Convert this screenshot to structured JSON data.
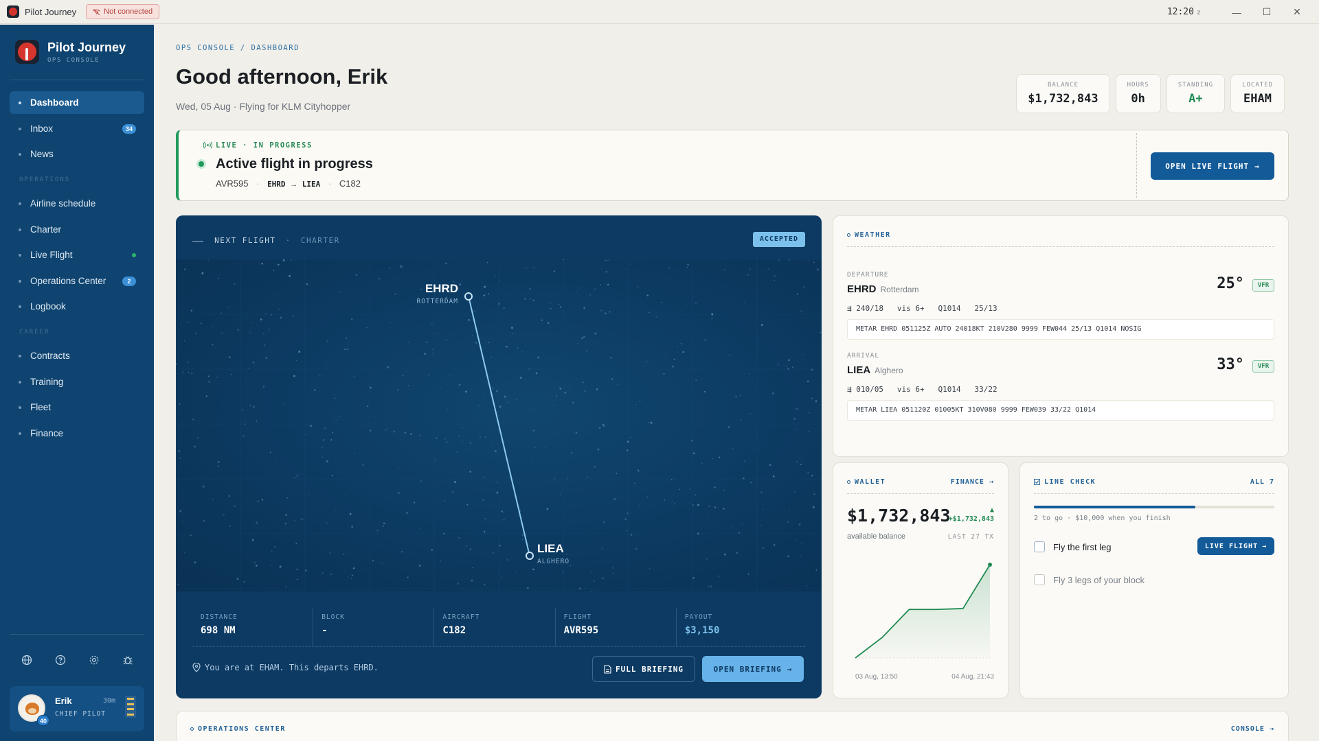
{
  "titlebar": {
    "app_name": "Pilot Journey",
    "connection_status": "Not connected",
    "clock": "12:20",
    "clock_suffix": "z"
  },
  "sidebar": {
    "brand_name": "Pilot Journey",
    "brand_sub": "OPS CONSOLE",
    "items": [
      {
        "label": "Dashboard",
        "active": true
      },
      {
        "label": "Inbox",
        "badge": "34"
      },
      {
        "label": "News"
      }
    ],
    "sections": [
      {
        "title": "OPERATIONS",
        "items": [
          {
            "label": "Airline schedule"
          },
          {
            "label": "Charter"
          },
          {
            "label": "Live Flight",
            "live": true
          },
          {
            "label": "Operations Center",
            "badge": "2"
          },
          {
            "label": "Logbook"
          }
        ]
      },
      {
        "title": "CAREER",
        "items": [
          {
            "label": "Contracts"
          },
          {
            "label": "Training"
          },
          {
            "label": "Fleet"
          },
          {
            "label": "Finance"
          }
        ]
      }
    ],
    "tools": [
      "globe-icon",
      "help-icon",
      "settings-icon",
      "bug-icon"
    ],
    "user": {
      "name": "Erik",
      "time": "30m",
      "role": "CHIEF PILOT",
      "level": "40"
    }
  },
  "header": {
    "breadcrumb": "OPS CONSOLE / DASHBOARD",
    "greeting": "Good afternoon, Erik",
    "subtitle": "Wed, 05 Aug · Flying for KLM Cityhopper",
    "stats": [
      {
        "label": "BALANCE",
        "value": "$1,732,843"
      },
      {
        "label": "HOURS",
        "value": "0h"
      },
      {
        "label": "STANDING",
        "value": "A+",
        "color": "#1f8a52"
      },
      {
        "label": "LOCATED",
        "value": "EHAM"
      }
    ]
  },
  "live_flight": {
    "status": "LIVE · IN PROGRESS",
    "title": "Active flight in progress",
    "flight": "AVR595",
    "from": "EHRD",
    "to": "LIEA",
    "aircraft": "C182",
    "button": "OPEN LIVE FLIGHT"
  },
  "next_flight": {
    "label": "NEXT FLIGHT",
    "type": "CHARTER",
    "status": "ACCEPTED",
    "departure": {
      "code": "EHRD",
      "city": "ROTTERDAM"
    },
    "arrival": {
      "code": "LIEA",
      "city": "ALGHERO"
    },
    "stats": [
      {
        "label": "DISTANCE",
        "value": "698 NM"
      },
      {
        "label": "BLOCK",
        "value": "-"
      },
      {
        "label": "AIRCRAFT",
        "value": "C182"
      },
      {
        "label": "FLIGHT",
        "value": "AVR595"
      },
      {
        "label": "PAYOUT",
        "value": "$3,150",
        "accent": true
      }
    ],
    "note": "You are at EHAM. This departs EHRD.",
    "full_briefing": "FULL BRIEFING",
    "open_briefing": "OPEN BRIEFING"
  },
  "weather": {
    "title": "WEATHER",
    "departure": {
      "label": "DEPARTURE",
      "code": "EHRD",
      "city": "Rotterdam",
      "temp": "25°",
      "category": "VFR",
      "wind": "240/18",
      "vis": "vis 6+",
      "qnh": "Q1014",
      "temp_dew": "25/13",
      "metar": "METAR EHRD 051125Z AUTO 24018KT 210V280 9999 FEW044 25/13 Q1014 NOSIG"
    },
    "arrival": {
      "label": "ARRIVAL",
      "code": "LIEA",
      "city": "Alghero",
      "temp": "33°",
      "category": "VFR",
      "wind": "010/05",
      "vis": "vis 6+",
      "qnh": "Q1014",
      "temp_dew": "33/22",
      "metar": "METAR LIEA 051120Z 01005KT 310V080 9999 FEW039 33/22 Q1014"
    }
  },
  "wallet": {
    "title": "WALLET",
    "link": "FINANCE",
    "amount": "$1,732,843",
    "delta": "+$1,732,843",
    "label": "available balance",
    "tx": "LAST 27 TX",
    "x_start": "03 Aug, 13:50",
    "x_end": "04 Aug, 21:43"
  },
  "line_check": {
    "title": "LINE CHECK",
    "link": "ALL 7",
    "progress": 0.67,
    "note": "2 to go · $10,000 when you finish",
    "tasks": [
      {
        "label": "Fly the first leg",
        "active": true
      },
      {
        "label": "Fly 3 legs of your block",
        "active": false
      }
    ],
    "button": "LIVE FLIGHT"
  },
  "ops_center": {
    "title": "OPERATIONS CENTER",
    "link": "CONSOLE"
  },
  "colors": {
    "sidebar": "#0f4470",
    "accent": "#135a98",
    "live": "#1f9a5b",
    "map": "#0c3a63"
  },
  "chart_data": {
    "type": "area",
    "x": [
      "03 Aug, 13:50",
      "",
      "",
      "",
      "",
      "04 Aug, 21:43"
    ],
    "series": [
      {
        "values": [
          0,
          0.22,
          0.52,
          0.52,
          0.53,
          1.0
        ]
      }
    ],
    "xlabel": "",
    "ylabel": ""
  }
}
